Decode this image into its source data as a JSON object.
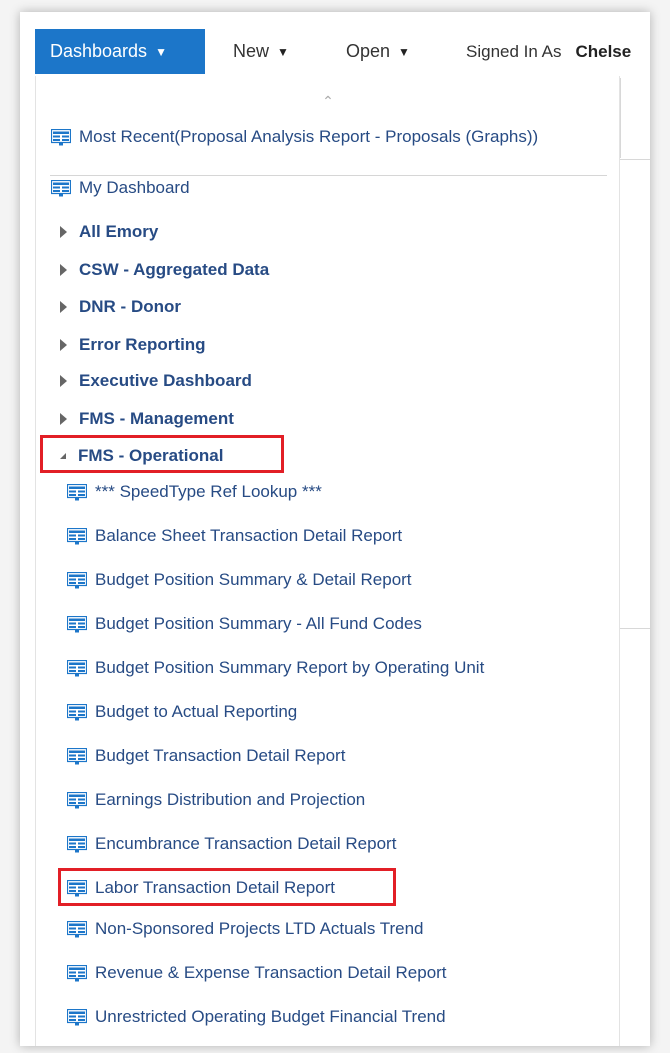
{
  "topbar": {
    "dashboards_label": "Dashboards",
    "new_label": "New",
    "open_label": "Open",
    "signed_in_label": "Signed In As",
    "user_name": "Chelse"
  },
  "menu": {
    "most_recent": "Most Recent(Proposal Analysis Report - Proposals (Graphs))",
    "my_dashboard": "My Dashboard",
    "folders": [
      "All Emory",
      "CSW - Aggregated Data",
      "DNR - Donor",
      "Error Reporting",
      "Executive Dashboard",
      "FMS - Management"
    ],
    "expanded_folder": "FMS - Operational",
    "reports": [
      "*** SpeedType Ref Lookup ***",
      "Balance Sheet Transaction Detail Report",
      "Budget Position Summary & Detail Report",
      "Budget Position Summary - All Fund Codes",
      "Budget Position Summary Report by Operating Unit",
      "Budget to Actual Reporting",
      "Budget Transaction Detail Report",
      "Earnings Distribution and Projection",
      "Encumbrance Transaction Detail Report",
      "Labor Transaction Detail Report",
      "Non-Sponsored Projects LTD Actuals Trend",
      "Revenue & Expense Transaction Detail Report",
      "Unrestricted Operating Budget Financial Trend"
    ]
  },
  "colors": {
    "accent": "#1c76c9",
    "link_text": "#274b84",
    "highlight": "#e21f26"
  },
  "icons": {
    "dashboard": "dashboard-icon",
    "expand": "triangle-right-icon",
    "collapse": "triangle-down-icon",
    "scroll": "chevron-up-icon"
  }
}
